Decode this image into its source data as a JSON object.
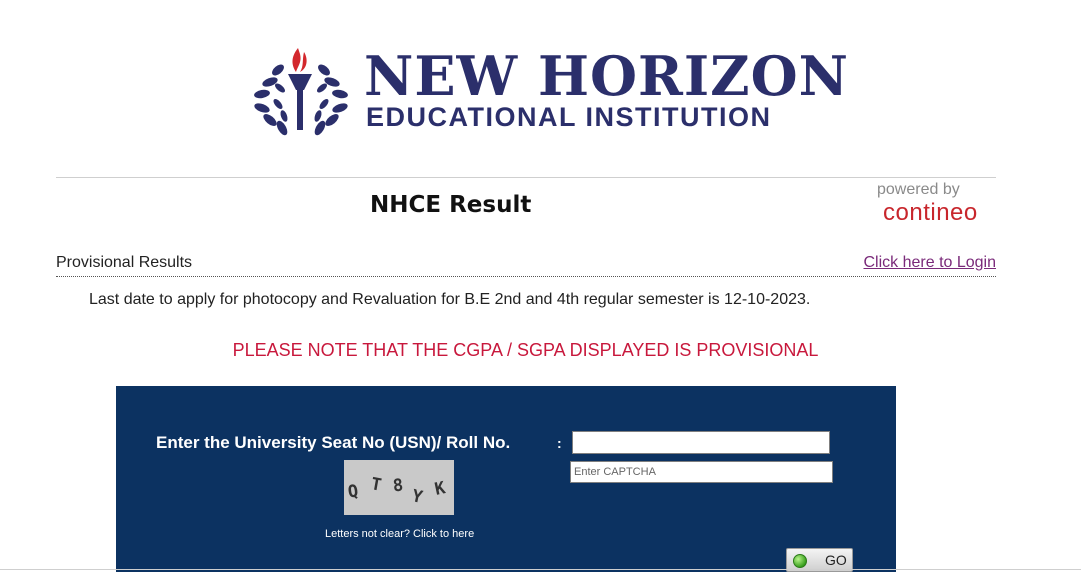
{
  "logo": {
    "line1": "NEW HORIZON",
    "line2": "EDUCATIONAL INSTITUTION",
    "color": "#2b2f6b",
    "flame_color": "#d3282d"
  },
  "header": {
    "title": "NHCE Result",
    "powered_by": "powered by",
    "brand": "contineo"
  },
  "subheader": {
    "left_label": "Provisional Results",
    "login_link": "Click here to Login"
  },
  "notice": "Last date to apply for photocopy and Revaluation for B.E 2nd and 4th regular semester is 12-10-2023.",
  "provisional_note": "PLEASE NOTE THAT THE CGPA / SGPA DISPLAYED IS PROVISIONAL",
  "form": {
    "usn_label": "Enter the University Seat No (USN)/ Roll No.",
    "colon": ":",
    "usn_value": "",
    "captcha_placeholder": "Enter CAPTCHA",
    "captcha_chars": [
      "Q",
      "T",
      "8",
      "Y",
      "K"
    ],
    "refresh_link": "Letters not clear? Click to here",
    "go_label": "GO",
    "panel_color": "#0c3261"
  }
}
